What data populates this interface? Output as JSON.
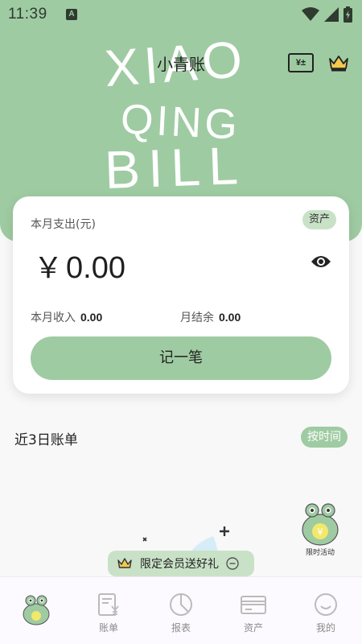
{
  "status_bar": {
    "time": "11:39",
    "badge": "A"
  },
  "header": {
    "decor": {
      "line1": "XIAO",
      "line2": "QING",
      "line3": "BILL"
    },
    "title": "小青账",
    "calc_icon": "¥±"
  },
  "summary": {
    "label": "本月支出(元)",
    "asset_pill": "资产",
    "currency": "￥",
    "amount": "0.00",
    "income_label": "本月收入",
    "income_value": "0.00",
    "balance_label": "月结余",
    "balance_value": "0.00",
    "record_button": "记一笔"
  },
  "recent": {
    "title": "近3日账单",
    "sort_pill": "按时间"
  },
  "floating": {
    "label": "限时活动"
  },
  "promo": {
    "text": "限定会员送好礼"
  },
  "nav": {
    "items": [
      {
        "label": "",
        "icon": "frog-mascot-icon"
      },
      {
        "label": "账单",
        "icon": "bill-icon"
      },
      {
        "label": "报表",
        "icon": "report-icon"
      },
      {
        "label": "资产",
        "icon": "asset-card-icon"
      },
      {
        "label": "我的",
        "icon": "profile-icon"
      }
    ]
  },
  "colors": {
    "primary": "#9fcba2",
    "pill_light": "#c9e2c7",
    "text": "#222222"
  }
}
